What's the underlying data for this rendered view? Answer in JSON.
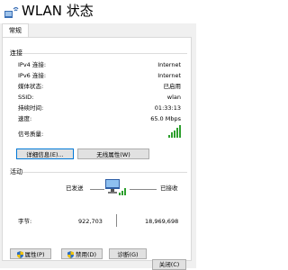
{
  "window": {
    "title": "WLAN 状态"
  },
  "tabs": [
    {
      "label": "常规"
    }
  ],
  "connection": {
    "group_title": "连接",
    "rows": [
      {
        "label": "IPv4 连接:",
        "value": "Internet"
      },
      {
        "label": "IPv6 连接:",
        "value": "Internet"
      },
      {
        "label": "媒体状态:",
        "value": "已启用"
      },
      {
        "label": "SSID:",
        "value": "wlan"
      },
      {
        "label": "持续时间:",
        "value": "01:33:13"
      },
      {
        "label": "速度:",
        "value": "65.0 Mbps"
      }
    ],
    "signal_label": "信号质量:",
    "signal_bars": 5,
    "details_button": "详细信息(E)...",
    "wireless_props_button": "无线属性(W)"
  },
  "activity": {
    "group_title": "活动",
    "sent_label": "已发送",
    "received_label": "已接收",
    "bytes_label": "字节:",
    "bytes_sent": "922,703",
    "bytes_received": "18,969,698"
  },
  "actions": {
    "properties_button": "属性(P)",
    "disable_button": "禁用(D)",
    "diagnose_button": "诊断(G)"
  },
  "footer": {
    "close_button": "关闭(C)"
  },
  "colors": {
    "signal": "#2e9f2e",
    "accent": "#0078d7"
  }
}
